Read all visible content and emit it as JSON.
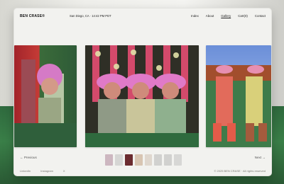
{
  "header": {
    "brand": "BEN CRASE®",
    "location_time": "San Diego, CA · 14:42 PM PDT",
    "nav_links": [
      "Index",
      "About",
      "Gallery",
      "Cart(0)",
      "Contact"
    ]
  },
  "gallery": {
    "previous_label": "← Previous",
    "next_label": "Next →",
    "thumbnail_count": 8,
    "active_thumbnail_index": 2,
    "colors": {
      "thumb_palette": [
        "#a06f87",
        "#b4b4b4",
        "#6b2b2f",
        "#b98d68",
        "#c7b6a6",
        "#a9a9a9",
        "#a8a8a8",
        "#b6b6b6"
      ]
    }
  },
  "footer": {
    "left_links": [
      "LinkedIn",
      "Instagram",
      "X"
    ],
    "copyright": "© 2025 BEN CRASE · All rights reserved"
  }
}
